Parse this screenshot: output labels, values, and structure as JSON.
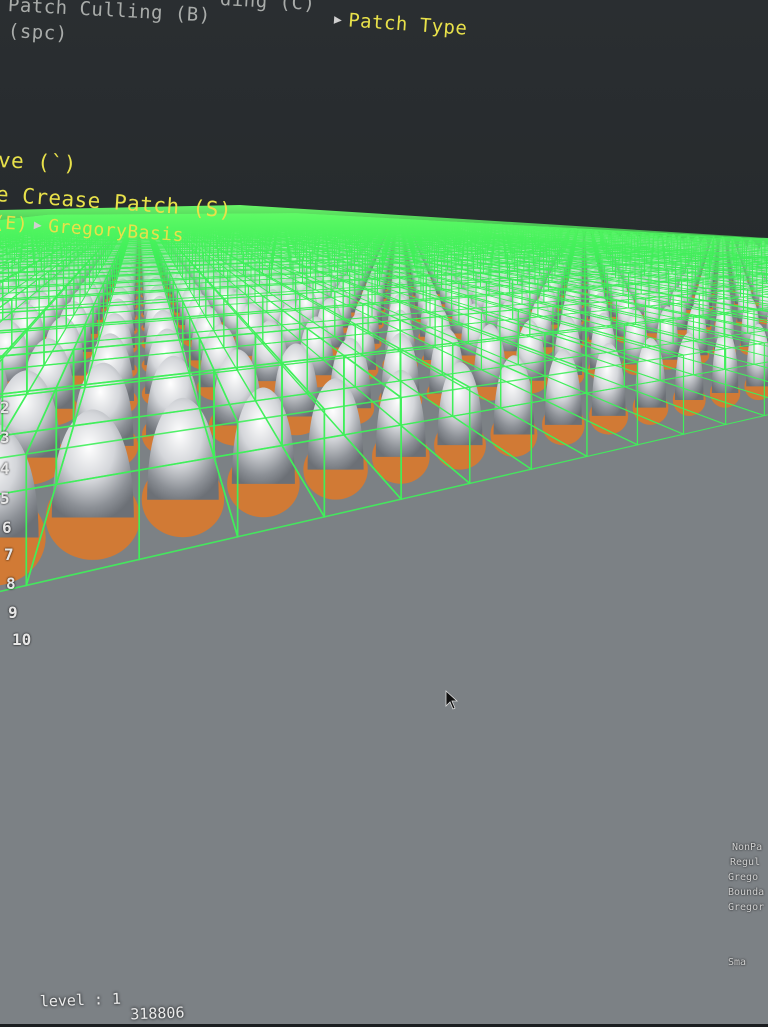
{
  "hud": {
    "top_line_left": "Patch Culling (B)",
    "top_line_middle": "ding (C)",
    "patch_type_label": "Patch Type",
    "top_line_sub": "(spc)",
    "adaptive_label": "ve (`)",
    "crease_label": "e Crease Patch (S)",
    "end_cap_label": "(E)",
    "end_cap_value": "GregoryBasis"
  },
  "level_buttons": [
    "2",
    "3",
    "4",
    "5",
    "6",
    "7",
    "8",
    "9",
    "10"
  ],
  "legend": {
    "items": [
      "NonPa",
      "Regul",
      "Grego",
      "Bounda",
      "Gregor"
    ],
    "footer": "Sma"
  },
  "stats": {
    "level_label": "level",
    "level_value": ": 1",
    "count_value": "318806"
  },
  "colors": {
    "hud_yellow": "#e8e14a",
    "wire_green": "#3ff05a",
    "bump_white": "#dcdde0",
    "bump_orange": "#d17a35",
    "ground_gray": "#8f9396"
  },
  "icons": {
    "cursor": "mouse-pointer-icon",
    "menu_arrow": "triangle-right-icon"
  }
}
